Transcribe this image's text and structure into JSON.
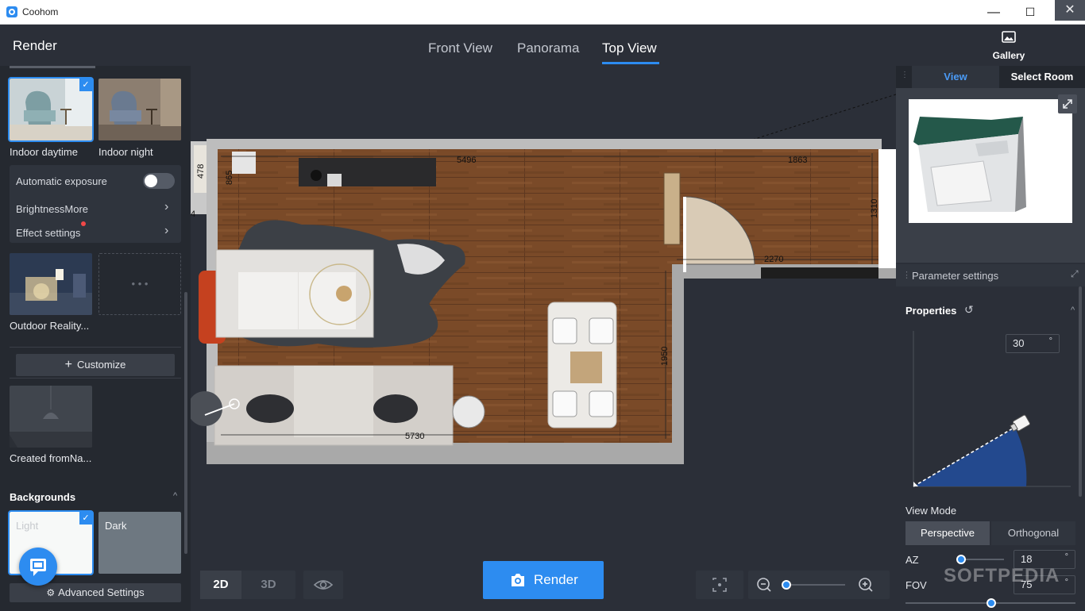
{
  "window": {
    "title": "Coohom",
    "minimize": "—",
    "maximize": "☐",
    "close": "✕"
  },
  "header": {
    "panel_title": "Render",
    "tabs": [
      {
        "label": "Front View",
        "active": false
      },
      {
        "label": "Panorama",
        "active": false
      },
      {
        "label": "Top View",
        "active": true
      }
    ],
    "gallery_label": "Gallery",
    "close": "✕"
  },
  "left": {
    "scenes": [
      {
        "label": "Indoor daytime",
        "selected": true
      },
      {
        "label": "Indoor night",
        "selected": false
      }
    ],
    "settings": {
      "automatic_exposure": "Automatic exposure",
      "brightness": "BrightnessMore",
      "effect_settings": "Effect settings"
    },
    "outdoor_label": "Outdoor Reality...",
    "more_dots": "• • •",
    "customize": "Customize",
    "customize_plus": "+",
    "created_label": "Created fromNa...",
    "backgrounds_title": "Backgrounds",
    "backgrounds_chevron": "^",
    "backgrounds": [
      {
        "label": "Light",
        "selected": true
      },
      {
        "label": "Dark",
        "selected": false
      }
    ],
    "advanced_settings": "Advanced Settings",
    "check": "✓"
  },
  "floorplan": {
    "dimensions": [
      "5496",
      "1863",
      "1310",
      "2270",
      "1950",
      "5730",
      "865",
      "478",
      "4"
    ]
  },
  "bottom": {
    "mode_2d": "2D",
    "mode_3d": "3D",
    "active_mode": "2D",
    "render_label": "Render"
  },
  "right": {
    "tabs": [
      {
        "label": "View",
        "active": true
      },
      {
        "label": "Select Room",
        "active": false
      }
    ],
    "parameter_settings": "Parameter settings",
    "properties": "Properties",
    "angle_value": "30",
    "degree": "°",
    "view_mode_label": "View Mode",
    "view_modes": [
      {
        "label": "Perspective",
        "active": true
      },
      {
        "label": "Orthogonal",
        "active": false
      }
    ],
    "az_label": "AZ",
    "az_value": "18",
    "fov_label": "FOV",
    "fov_value": "75"
  },
  "watermark": "SOFTPEDIA",
  "colors": {
    "accent": "#2d8cf0",
    "panel": "#252930",
    "background": "#2b2f38"
  }
}
